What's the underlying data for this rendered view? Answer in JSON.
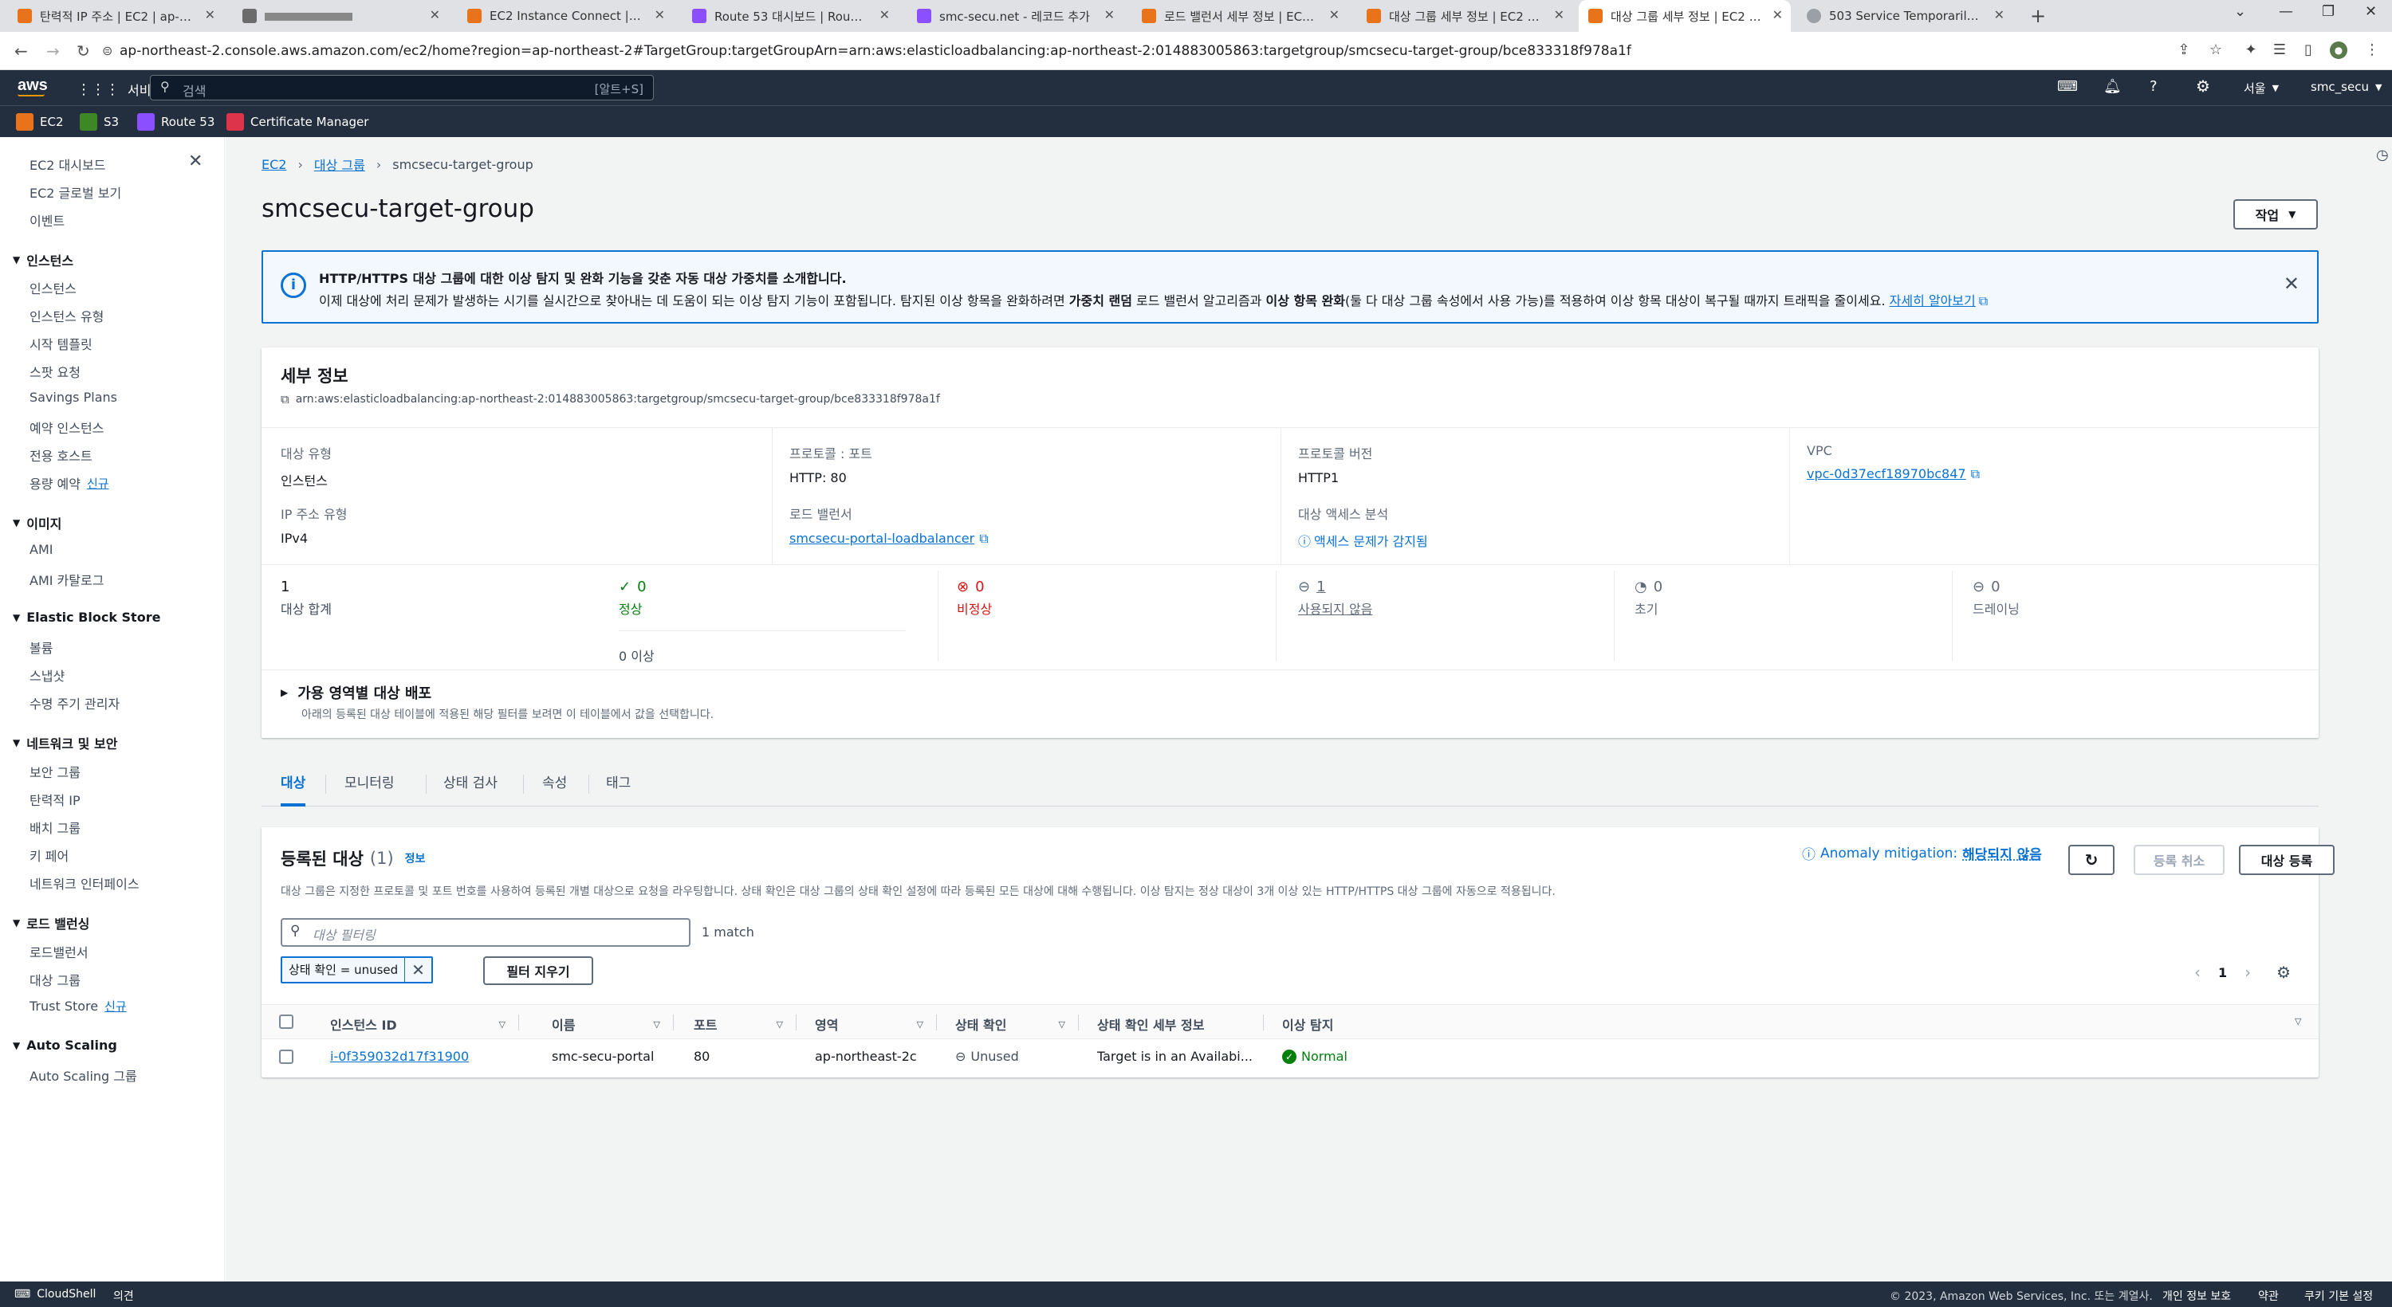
{
  "browser": {
    "tabs": [
      {
        "title": "탄력적 IP 주소 | EC2 | ap-northeast-2",
        "color": "#e8731a"
      },
      {
        "title": "",
        "color": "#6b6b6b"
      },
      {
        "title": "EC2 Instance Connect | ap-northeast-2",
        "color": "#e8731a"
      },
      {
        "title": "Route 53 대시보드 | Route 53",
        "color": "#8c4fff"
      },
      {
        "title": "smc-secu.net - 레코드 추가",
        "color": "#8c4fff"
      },
      {
        "title": "로드 밸런서 세부 정보 | EC2 | ap-northeast-2",
        "color": "#e8731a"
      },
      {
        "title": "대상 그룹 세부 정보 | EC2 | ap-northeast-2",
        "color": "#e8731a"
      },
      {
        "title": "대상 그룹 세부 정보 | EC2 | ap-northeast-2",
        "color": "#e8731a"
      },
      {
        "title": "503 Service Temporarily Unavailable",
        "color": "#9aa0a6"
      }
    ],
    "url": "ap-northeast-2.console.aws.amazon.com/ec2/home?region=ap-northeast-2#TargetGroup:targetGroupArn=arn:aws:elasticloadbalancing:ap-northeast-2:014883005863:targetgroup/smcsecu-target-group/bce833318f978a1f"
  },
  "aws_nav": {
    "logo": "aws",
    "services": "서비스",
    "search_placeholder": "검색",
    "search_shortcut": "[알트+S]",
    "region": "서울",
    "user": "smc_secu",
    "favorites": [
      {
        "label": "EC2",
        "color": "#e8731a"
      },
      {
        "label": "S3",
        "color": "#3f8624"
      },
      {
        "label": "Route 53",
        "color": "#8c4fff"
      },
      {
        "label": "Certificate Manager",
        "color": "#dd344c"
      }
    ]
  },
  "sidebar": {
    "top": [
      "EC2 대시보드",
      "EC2 글로벌 보기",
      "이벤트"
    ],
    "sections": [
      {
        "title": "인스턴스",
        "items": [
          "인스턴스",
          "인스턴스 유형",
          "시작 템플릿",
          "스팟 요청",
          "Savings Plans",
          "예약 인스턴스",
          "전용 호스트",
          "용량 예약"
        ]
      },
      {
        "title": "이미지",
        "items": [
          "AMI",
          "AMI 카탈로그"
        ]
      },
      {
        "title": "Elastic Block Store",
        "items": [
          "볼륨",
          "스냅샷",
          "수명 주기 관리자"
        ]
      },
      {
        "title": "네트워크 및 보안",
        "items": [
          "보안 그룹",
          "탄력적 IP",
          "배치 그룹",
          "키 페어",
          "네트워크 인터페이스"
        ]
      },
      {
        "title": "로드 밸런싱",
        "items": [
          "로드밸런서",
          "대상 그룹",
          "Trust Store"
        ]
      },
      {
        "title": "Auto Scaling",
        "items": [
          "Auto Scaling 그룹"
        ]
      }
    ],
    "new_badge": "신규"
  },
  "breadcrumb": [
    "EC2",
    "대상 그룹",
    "smcsecu-target-group"
  ],
  "page_title": "smcsecu-target-group",
  "actions_label": "작업",
  "flash": {
    "title": "HTTP/HTTPS 대상 그룹에 대한 이상 탐지 및 완화 기능을 갖춘 자동 대상 가중치를 소개합니다.",
    "body_1": "이제 대상에 처리 문제가 발생하는 시기를 실시간으로 찾아내는 데 도움이 되는 이상 탐지 기능이 포함됩니다. 탐지된 이상 항목을 완화하려면 ",
    "bold_1": "가중치 랜덤",
    "body_2": " 로드 밸런서 알고리즘과 ",
    "bold_2": "이상 항목 완화",
    "body_3": "(둘 다 대상 그룹 속성에서 사용 가능)를 적용하여 이상 항목 대상이 복구될 때까지 트래픽을 줄이세요. ",
    "link": "자세히 알아보기"
  },
  "details": {
    "title": "세부 정보",
    "arn": "arn:aws:elasticloadbalancing:ap-northeast-2:014883005863:targetgroup/smcsecu-target-group/bce833318f978a1f",
    "target_type_label": "대상 유형",
    "target_type": "인스턴스",
    "protocol_port_label": "프로토콜 : 포트",
    "protocol_port": "HTTP: 80",
    "protocol_version_label": "프로토콜 버전",
    "protocol_version": "HTTP1",
    "vpc_label": "VPC",
    "vpc": "vpc-0d37ecf18970bc847",
    "ip_type_label": "IP 주소 유형",
    "ip_type": "IPv4",
    "lb_label": "로드 밸런서",
    "lb": "smcsecu-portal-loadbalancer",
    "access_label": "대상 액세스 분석",
    "access": "액세스 문제가 감지됨",
    "stats": {
      "total": "1",
      "total_label": "대상 합계",
      "healthy": "0",
      "healthy_label": "정상",
      "anomaly": "0 이상",
      "unhealthy": "0",
      "unhealthy_label": "비정상",
      "unused": "1",
      "unused_label": "사용되지 않음",
      "initial": "0",
      "initial_label": "초기",
      "draining": "0",
      "draining_label": "드레이닝"
    },
    "az_title": "가용 영역별 대상 배포",
    "az_desc": "아래의 등록된 대상 테이블에 적용된 해당 필터를 보려면 이 테이블에서 값을 선택합니다."
  },
  "tabs": [
    "대상",
    "모니터링",
    "상태 검사",
    "속성",
    "태그"
  ],
  "targets": {
    "title": "등록된 대상",
    "count": "(1)",
    "info": "정보",
    "anomaly_label": "Anomaly mitigation:",
    "anomaly_value": "해당되지 않음",
    "deregister": "등록 취소",
    "register": "대상 등록",
    "desc": "대상 그룹은 지정한 프로토콜 및 포트 번호를 사용하여 등록된 개별 대상으로 요청을 라우팅합니다. 상태 확인은 대상 그룹의 상태 확인 설정에 따라 등록된 모든 대상에 대해 수행됩니다. 이상 탐지는 정상 대상이 3개 이상 있는 HTTP/HTTPS 대상 그룹에 자동으로 적용됩니다.",
    "filter_placeholder": "대상 필터링",
    "match": "1 match",
    "chip": "상태 확인 = unused",
    "clear": "필터 지우기",
    "page": "1",
    "columns": [
      "인스턴스 ID",
      "이름",
      "포트",
      "영역",
      "상태 확인",
      "상태 확인 세부 정보",
      "이상 탐지"
    ],
    "rows": [
      {
        "id": "i-0f359032d17f31900",
        "name": "smc-secu-portal",
        "port": "80",
        "zone": "ap-northeast-2c",
        "health": "Unused",
        "detail": "Target is in an Availabi...",
        "anomaly": "Normal"
      }
    ]
  },
  "footer": {
    "cloudshell": "CloudShell",
    "feedback": "의견",
    "copyright": "© 2023, Amazon Web Services, Inc. 또는 계열사.",
    "privacy": "개인 정보 보호",
    "terms": "약관",
    "cookies": "쿠키 기본 설정"
  }
}
